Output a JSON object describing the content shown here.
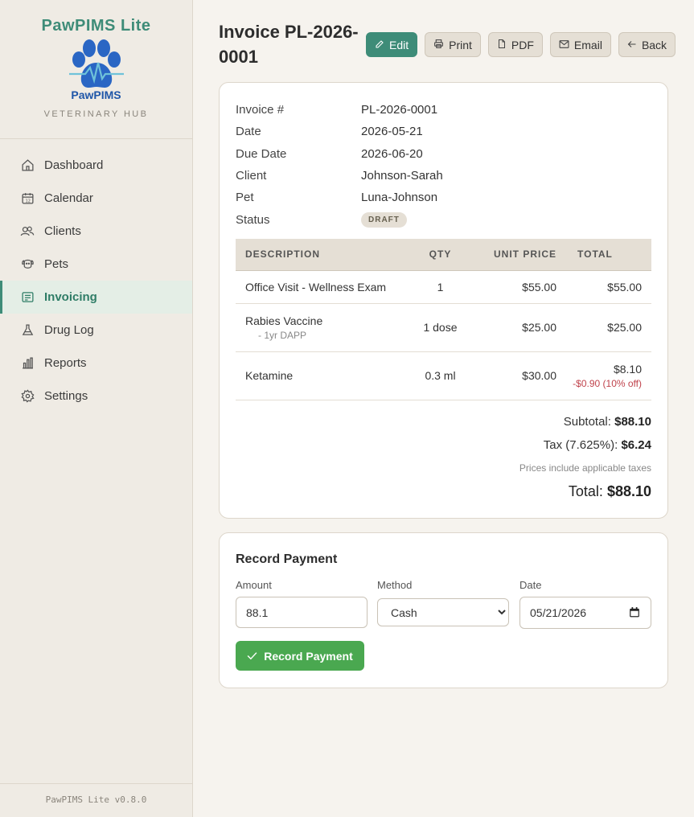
{
  "app": {
    "title": "PawPIMS Lite",
    "logo_text": "PawPIMS",
    "subtitle": "VETERINARY HUB",
    "version": "PawPIMS Lite v0.8.0"
  },
  "nav": [
    {
      "label": "Dashboard",
      "icon": "home-icon",
      "active": false
    },
    {
      "label": "Calendar",
      "icon": "calendar-icon",
      "active": false
    },
    {
      "label": "Clients",
      "icon": "users-icon",
      "active": false
    },
    {
      "label": "Pets",
      "icon": "dog-icon",
      "active": false
    },
    {
      "label": "Invoicing",
      "icon": "invoice-icon",
      "active": true
    },
    {
      "label": "Drug Log",
      "icon": "flask-icon",
      "active": false
    },
    {
      "label": "Reports",
      "icon": "bar-chart-icon",
      "active": false
    },
    {
      "label": "Settings",
      "icon": "gear-icon",
      "active": false
    }
  ],
  "header": {
    "title": "Invoice PL-2026-0001",
    "actions": {
      "edit": "Edit",
      "print": "Print",
      "pdf": "PDF",
      "email": "Email",
      "back": "Back"
    }
  },
  "invoice": {
    "meta": [
      {
        "label": "Invoice #",
        "value": "PL-2026-0001"
      },
      {
        "label": "Date",
        "value": "2026-05-21"
      },
      {
        "label": "Due Date",
        "value": "2026-06-20"
      },
      {
        "label": "Client",
        "value": "Johnson-Sarah"
      },
      {
        "label": "Pet",
        "value": "Luna-Johnson"
      }
    ],
    "status_label": "Status",
    "status": "DRAFT",
    "columns": {
      "description": "DESCRIPTION",
      "qty": "QTY",
      "unit_price": "UNIT PRICE",
      "total": "TOTAL"
    },
    "items": [
      {
        "description": "Office Visit - Wellness Exam",
        "note": "",
        "qty": "1",
        "unit_price": "$55.00",
        "total": "$55.00",
        "discount": ""
      },
      {
        "description": "Rabies Vaccine",
        "note": "- 1yr DAPP",
        "qty": "1 dose",
        "unit_price": "$25.00",
        "total": "$25.00",
        "discount": ""
      },
      {
        "description": "Ketamine",
        "note": "",
        "qty": "0.3 ml",
        "unit_price": "$30.00",
        "total": "$8.10",
        "discount": "-$0.90 (10% off)"
      }
    ],
    "subtotal_label": "Subtotal:",
    "subtotal": "$88.10",
    "tax_label": "Tax (7.625%):",
    "tax": "$6.24",
    "tax_note": "Prices include applicable taxes",
    "total_label": "Total:",
    "total": "$88.10"
  },
  "payment": {
    "title": "Record Payment",
    "amount_label": "Amount",
    "amount_value": "88.1",
    "method_label": "Method",
    "method_value": "Cash",
    "date_label": "Date",
    "date_value": "05/21/2026",
    "submit_label": "Record Payment"
  },
  "colors": {
    "brand": "#3e8c78",
    "success": "#4aa850",
    "discount": "#c0434c"
  }
}
